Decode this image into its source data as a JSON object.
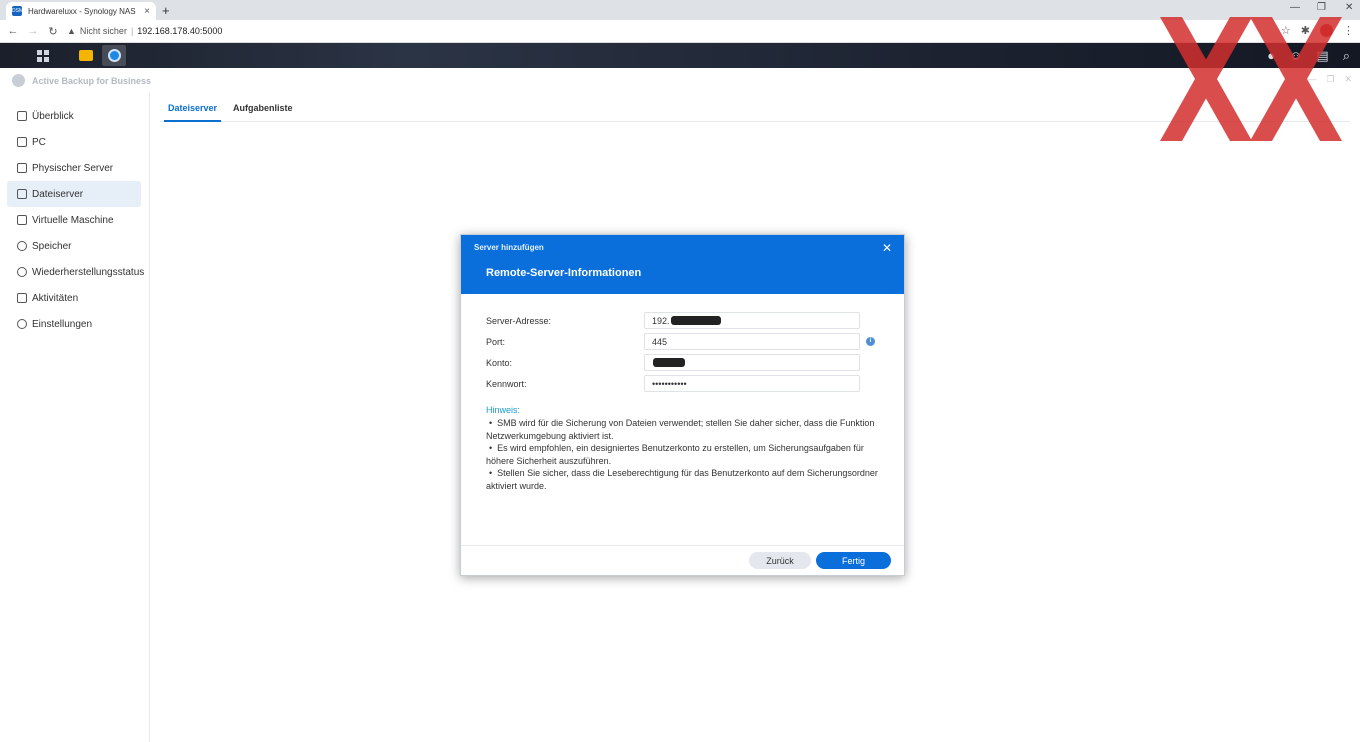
{
  "browser": {
    "tab_title": "Hardwareluxx - Synology NAS",
    "new_tab": "+",
    "not_secure": "Nicht sicher",
    "separator": "|",
    "url": "192.168.178.40:5000"
  },
  "app": {
    "title": "Active Backup for Business"
  },
  "sidebar": {
    "items": [
      {
        "label": "Überblick",
        "icon": "overview-icon"
      },
      {
        "label": "PC",
        "icon": "pc-icon"
      },
      {
        "label": "Physischer Server",
        "icon": "server-icon"
      },
      {
        "label": "Dateiserver",
        "icon": "file-server-icon"
      },
      {
        "label": "Virtuelle Maschine",
        "icon": "vm-icon"
      },
      {
        "label": "Speicher",
        "icon": "storage-icon"
      },
      {
        "label": "Wiederherstellungsstatus",
        "icon": "restore-icon"
      },
      {
        "label": "Aktivitäten",
        "icon": "activity-icon"
      },
      {
        "label": "Einstellungen",
        "icon": "gear-icon"
      }
    ],
    "active_index": 3
  },
  "tabs": [
    {
      "label": "Dateiserver",
      "active": true
    },
    {
      "label": "Aufgabenliste",
      "active": false
    }
  ],
  "dialog": {
    "window_title": "Server hinzufügen",
    "heading": "Remote-Server-Informationen",
    "fields": {
      "server_label": "Server-Adresse:",
      "server_value": "192.",
      "port_label": "Port:",
      "port_value": "445",
      "account_label": "Konto:",
      "password_label": "Kennwort:",
      "password_value": "•••••••••••"
    },
    "note": {
      "heading": "Hinweis:",
      "items": [
        "SMB wird für die Sicherung von Dateien verwendet; stellen Sie daher sicher, dass die Funktion Netzwerkumgebung aktiviert ist.",
        "Es wird empfohlen, ein designiertes Benutzerkonto zu erstellen, um Sicherungsaufgaben für höhere Sicherheit auszuführen.",
        "Stellen Sie sicher, dass die Leseberechtigung für das Benutzerkonto auf dem Sicherungsordner aktiviert wurde."
      ]
    },
    "buttons": {
      "back": "Zurück",
      "done": "Fertig"
    }
  },
  "colors": {
    "accent": "#0a6fdb",
    "note_heading": "#1a9bd6",
    "watermark": "#d32f2f"
  }
}
